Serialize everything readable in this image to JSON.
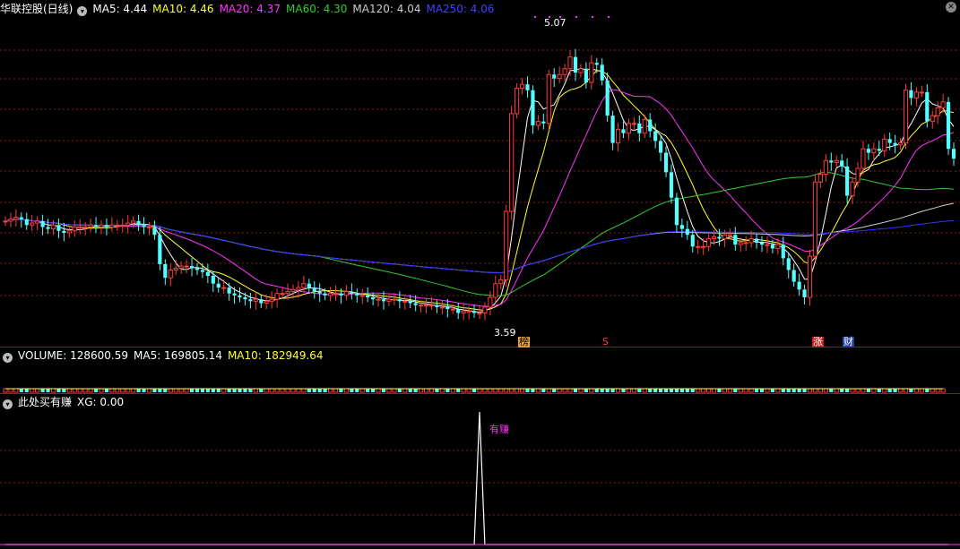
{
  "header": {
    "stock_name": "华联控股(日线)",
    "ma5": "MA5: 4.44",
    "ma10": "MA10: 4.46",
    "ma20": "MA20: 4.37",
    "ma60": "MA60: 4.30",
    "ma120": "MA120: 4.04",
    "ma250": "MA250: 4.06"
  },
  "volume_header": {
    "volume": "VOLUME: 128600.59",
    "ma5": "MA5: 169805.14",
    "ma10": "MA10: 182949.64"
  },
  "indicator_header": {
    "name": "此处买有赚",
    "xg": "XG: 0.00"
  },
  "annotations": {
    "high_price": "5.07",
    "low_price": "3.59",
    "signal_label": "有赚",
    "tag_bang": "榜",
    "tag_s": "S",
    "tag_zhang": "涨",
    "tag_cai": "财"
  },
  "colors": {
    "up": "#ff3b3b",
    "down": "#54ffff",
    "ma5": "#ffffff",
    "ma10": "#ffff33",
    "ma20": "#ff33ff",
    "ma60": "#33cc33",
    "ma120": "#cccccc",
    "ma250": "#3333ff",
    "grid": "#8b1a1a"
  },
  "chart_data": [
    {
      "type": "candlestick",
      "title": "华联控股(日线)",
      "ylim": [
        3.5,
        5.15
      ],
      "x": [
        0,
        1,
        2,
        3,
        4,
        5,
        6,
        7,
        8,
        9,
        10,
        11,
        12,
        13,
        14,
        15,
        16,
        17,
        18,
        19,
        20,
        21,
        22,
        23,
        24,
        25,
        26,
        27,
        28,
        29,
        30,
        31,
        32,
        33,
        34,
        35,
        36,
        37,
        38,
        39,
        40,
        41,
        42,
        43,
        44,
        45,
        46,
        47,
        48,
        49,
        50,
        51,
        52,
        53,
        54,
        55,
        56,
        57,
        58,
        59,
        60,
        61,
        62,
        63,
        64,
        65,
        66,
        67,
        68,
        69,
        70,
        71,
        72,
        73,
        74,
        75,
        76,
        77,
        78,
        79,
        80,
        81,
        82,
        83,
        84,
        85,
        86,
        87,
        88,
        89,
        90,
        91,
        92,
        93,
        94,
        95,
        96,
        97,
        98,
        99,
        100,
        101,
        102,
        103,
        104,
        105,
        106,
        107,
        108,
        109,
        110,
        111,
        112,
        113,
        114,
        115,
        116,
        117,
        118,
        119,
        120,
        121,
        122,
        123,
        124,
        125,
        126,
        127,
        128,
        129,
        130,
        131,
        132,
        133,
        134,
        135,
        136,
        137,
        138,
        139,
        140,
        141,
        142,
        143,
        144,
        145,
        146,
        147,
        148,
        149,
        150,
        151,
        152,
        153,
        154,
        155,
        156,
        157,
        158,
        159,
        160,
        161,
        162,
        163,
        164,
        165,
        166,
        167,
        168,
        169,
        170,
        171,
        172,
        173,
        174,
        175,
        176
      ],
      "close": [
        4.11,
        4.12,
        4.13,
        4.12,
        4.09,
        4.1,
        4.11,
        4.08,
        4.07,
        4.09,
        4.06,
        4.05,
        4.06,
        4.08,
        4.08,
        4.08,
        4.09,
        4.08,
        4.09,
        4.08,
        4.09,
        4.09,
        4.09,
        4.1,
        4.11,
        4.09,
        4.08,
        4.08,
        4.04,
        3.89,
        3.82,
        3.86,
        3.87,
        3.88,
        3.88,
        3.87,
        3.86,
        3.85,
        3.83,
        3.79,
        3.77,
        3.77,
        3.74,
        3.73,
        3.72,
        3.71,
        3.7,
        3.71,
        3.69,
        3.7,
        3.71,
        3.74,
        3.74,
        3.75,
        3.76,
        3.77,
        3.79,
        3.77,
        3.75,
        3.74,
        3.73,
        3.74,
        3.74,
        3.73,
        3.75,
        3.74,
        3.73,
        3.73,
        3.72,
        3.71,
        3.71,
        3.7,
        3.71,
        3.71,
        3.7,
        3.7,
        3.69,
        3.68,
        3.68,
        3.68,
        3.68,
        3.67,
        3.67,
        3.66,
        3.66,
        3.64,
        3.65,
        3.65,
        3.64,
        3.64,
        3.67,
        3.72,
        3.79,
        3.81,
        4.16,
        4.66,
        4.79,
        4.81,
        4.78,
        4.6,
        4.62,
        4.61,
        4.86,
        4.84,
        4.86,
        4.89,
        4.95,
        4.87,
        4.89,
        4.82,
        4.92,
        4.91,
        4.83,
        4.65,
        4.51,
        4.58,
        4.56,
        4.61,
        4.61,
        4.56,
        4.63,
        4.57,
        4.52,
        4.46,
        4.36,
        4.23,
        4.09,
        4.07,
        4.04,
        3.98,
        3.98,
        3.98,
        4.02,
        4.03,
        4.02,
        4.04,
        4.04,
        3.99,
        4.0,
        4.0,
        4.02,
        4.0,
        3.99,
        3.99,
        3.97,
        3.99,
        3.92,
        3.86,
        3.8,
        3.76,
        3.72,
        3.93,
        4.31,
        4.35,
        4.42,
        4.41,
        4.42,
        4.39,
        4.24,
        4.31,
        4.38,
        4.48,
        4.46,
        4.48,
        4.47,
        4.53,
        4.51,
        4.5,
        4.51,
        4.78,
        4.74,
        4.77,
        4.77,
        4.62,
        4.65,
        4.69,
        4.72,
        4.48,
        4.43
      ],
      "annotations": [
        "5.07",
        "3.59"
      ]
    },
    {
      "type": "bar",
      "title": "VOLUME",
      "x": [
        0,
        1,
        2,
        3,
        4,
        5,
        6,
        7,
        8,
        9,
        10,
        11,
        12,
        13,
        14,
        15,
        16,
        17,
        18,
        19,
        20,
        21,
        22,
        23,
        24,
        25,
        26,
        27,
        28,
        29,
        30,
        31,
        32,
        33,
        34,
        35,
        36,
        37,
        38,
        39,
        40,
        41,
        42,
        43,
        44,
        45,
        46,
        47,
        48,
        49,
        50,
        51,
        52,
        53,
        54,
        55,
        56,
        57,
        58,
        59,
        60,
        61,
        62,
        63,
        64,
        65,
        66,
        67,
        68,
        69,
        70,
        71,
        72,
        73,
        74,
        75,
        76,
        77,
        78,
        79,
        80,
        81,
        82,
        83,
        84,
        85,
        86,
        87,
        88,
        89,
        90,
        91,
        92,
        93,
        94,
        95,
        96,
        97,
        98,
        99,
        100,
        101,
        102,
        103,
        104,
        105,
        106,
        107,
        108,
        109,
        110,
        111,
        112,
        113,
        114,
        115,
        116,
        117,
        118,
        119,
        120,
        121,
        122,
        123,
        124,
        125,
        126,
        127,
        128,
        129,
        130,
        131,
        132,
        133,
        134,
        135,
        136,
        137,
        138,
        139,
        140,
        141,
        142,
        143,
        144,
        145,
        146,
        147,
        148,
        149,
        150,
        151,
        152,
        153,
        154,
        155,
        156,
        157,
        158,
        159,
        160,
        161,
        162,
        163,
        164,
        165,
        166,
        167,
        168,
        169,
        170,
        171,
        172,
        173,
        174,
        175,
        176
      ],
      "values": [
        5,
        5,
        5,
        5,
        5,
        5,
        5,
        5,
        5,
        5,
        5,
        5,
        5,
        5,
        5,
        5,
        5,
        5,
        5,
        5,
        5,
        5,
        5,
        5,
        5,
        5,
        5,
        5,
        5,
        5,
        5,
        5,
        5,
        5,
        5,
        5,
        5,
        5,
        5,
        5,
        5,
        5,
        5,
        5,
        5,
        5,
        5,
        5,
        5,
        5,
        5,
        5,
        5,
        5,
        5,
        5,
        5,
        5,
        5,
        5,
        5,
        5,
        5,
        5,
        5,
        5,
        5,
        5,
        5,
        5,
        5,
        5,
        5,
        5,
        5,
        5,
        5,
        5,
        5,
        5,
        5,
        5,
        5,
        5,
        5,
        5,
        5,
        5,
        5,
        5,
        5,
        5,
        5,
        5,
        5,
        5,
        5,
        5,
        5,
        5,
        5,
        5,
        5,
        5,
        5,
        5,
        5,
        5,
        5,
        5,
        5,
        5,
        5,
        5,
        5,
        5,
        5,
        5,
        5,
        5,
        5,
        5,
        5,
        5,
        5,
        5,
        5,
        5,
        5,
        5,
        5,
        5,
        5,
        5,
        5,
        5,
        5,
        5,
        5,
        5,
        5,
        5,
        5,
        5,
        5,
        5,
        5,
        5,
        5,
        5,
        5,
        5,
        5,
        5,
        5,
        5,
        5,
        5,
        5,
        5,
        5,
        5,
        5,
        5,
        5,
        5,
        5,
        5,
        5,
        5,
        5,
        5,
        5,
        5,
        5,
        5,
        5
      ]
    },
    {
      "type": "line",
      "title": "此处买有赚",
      "x": [
        0,
        1,
        2,
        3,
        4,
        5,
        6,
        7,
        8,
        9,
        10,
        11,
        12,
        13,
        14,
        15,
        16,
        17,
        18,
        19,
        20,
        21,
        22,
        23,
        24,
        25,
        26,
        27,
        28,
        29,
        30,
        31,
        32,
        33,
        34,
        35,
        36,
        37,
        38,
        39,
        40,
        41,
        42,
        43,
        44,
        45,
        46,
        47,
        48,
        49,
        50,
        51,
        52,
        53,
        54,
        55,
        56,
        57,
        58,
        59,
        60,
        61,
        62,
        63,
        64,
        65,
        66,
        67,
        68,
        69,
        70,
        71,
        72,
        73,
        74,
        75,
        76,
        77,
        78,
        79,
        80,
        81,
        82,
        83,
        84,
        85,
        86,
        87,
        88,
        89,
        90,
        91,
        92,
        93,
        94,
        95,
        96,
        97,
        98,
        99,
        100,
        101,
        102,
        103,
        104,
        105,
        106,
        107,
        108,
        109,
        110,
        111,
        112,
        113,
        114,
        115,
        116,
        117,
        118,
        119,
        120,
        121,
        122,
        123,
        124,
        125,
        126,
        127,
        128,
        129,
        130,
        131,
        132,
        133,
        134,
        135,
        136,
        137,
        138,
        139,
        140,
        141,
        142,
        143,
        144,
        145,
        146,
        147,
        148,
        149,
        150,
        151,
        152,
        153,
        154,
        155,
        156,
        157,
        158,
        159,
        160,
        161,
        162,
        163,
        164,
        165,
        166,
        167,
        168,
        169,
        170,
        171,
        172,
        173,
        174,
        175,
        176
      ],
      "values": [
        0,
        0,
        0,
        0,
        0,
        0,
        0,
        0,
        0,
        0,
        0,
        0,
        0,
        0,
        0,
        0,
        0,
        0,
        0,
        0,
        0,
        0,
        0,
        0,
        0,
        0,
        0,
        0,
        0,
        0,
        0,
        0,
        0,
        0,
        0,
        0,
        0,
        0,
        0,
        0,
        0,
        0,
        0,
        0,
        0,
        0,
        0,
        0,
        0,
        0,
        0,
        0,
        0,
        0,
        0,
        0,
        0,
        0,
        0,
        0,
        0,
        0,
        0,
        0,
        0,
        0,
        0,
        0,
        0,
        0,
        0,
        0,
        0,
        0,
        0,
        0,
        0,
        0,
        0,
        0,
        0,
        0,
        0,
        0,
        0,
        0,
        0,
        0,
        0,
        1,
        0,
        0,
        0,
        0,
        0,
        0,
        0,
        0,
        0,
        0,
        0,
        0,
        0,
        0,
        0,
        0,
        0,
        0,
        0,
        0,
        0,
        0,
        0,
        0,
        0,
        0,
        0,
        0,
        0,
        0,
        0,
        0,
        0,
        0,
        0,
        0,
        0,
        0,
        0,
        0,
        0,
        0,
        0,
        0,
        0,
        0,
        0,
        0,
        0,
        0,
        0,
        0,
        0,
        0,
        0,
        0,
        0,
        0,
        0,
        0,
        0,
        0,
        0,
        0,
        0,
        0,
        0,
        0,
        0,
        0,
        0,
        0,
        0,
        0,
        0,
        0,
        0,
        0,
        0,
        0,
        0,
        0,
        0,
        0,
        0,
        0,
        0,
        0
      ],
      "annotations": [
        "有赚"
      ]
    }
  ]
}
